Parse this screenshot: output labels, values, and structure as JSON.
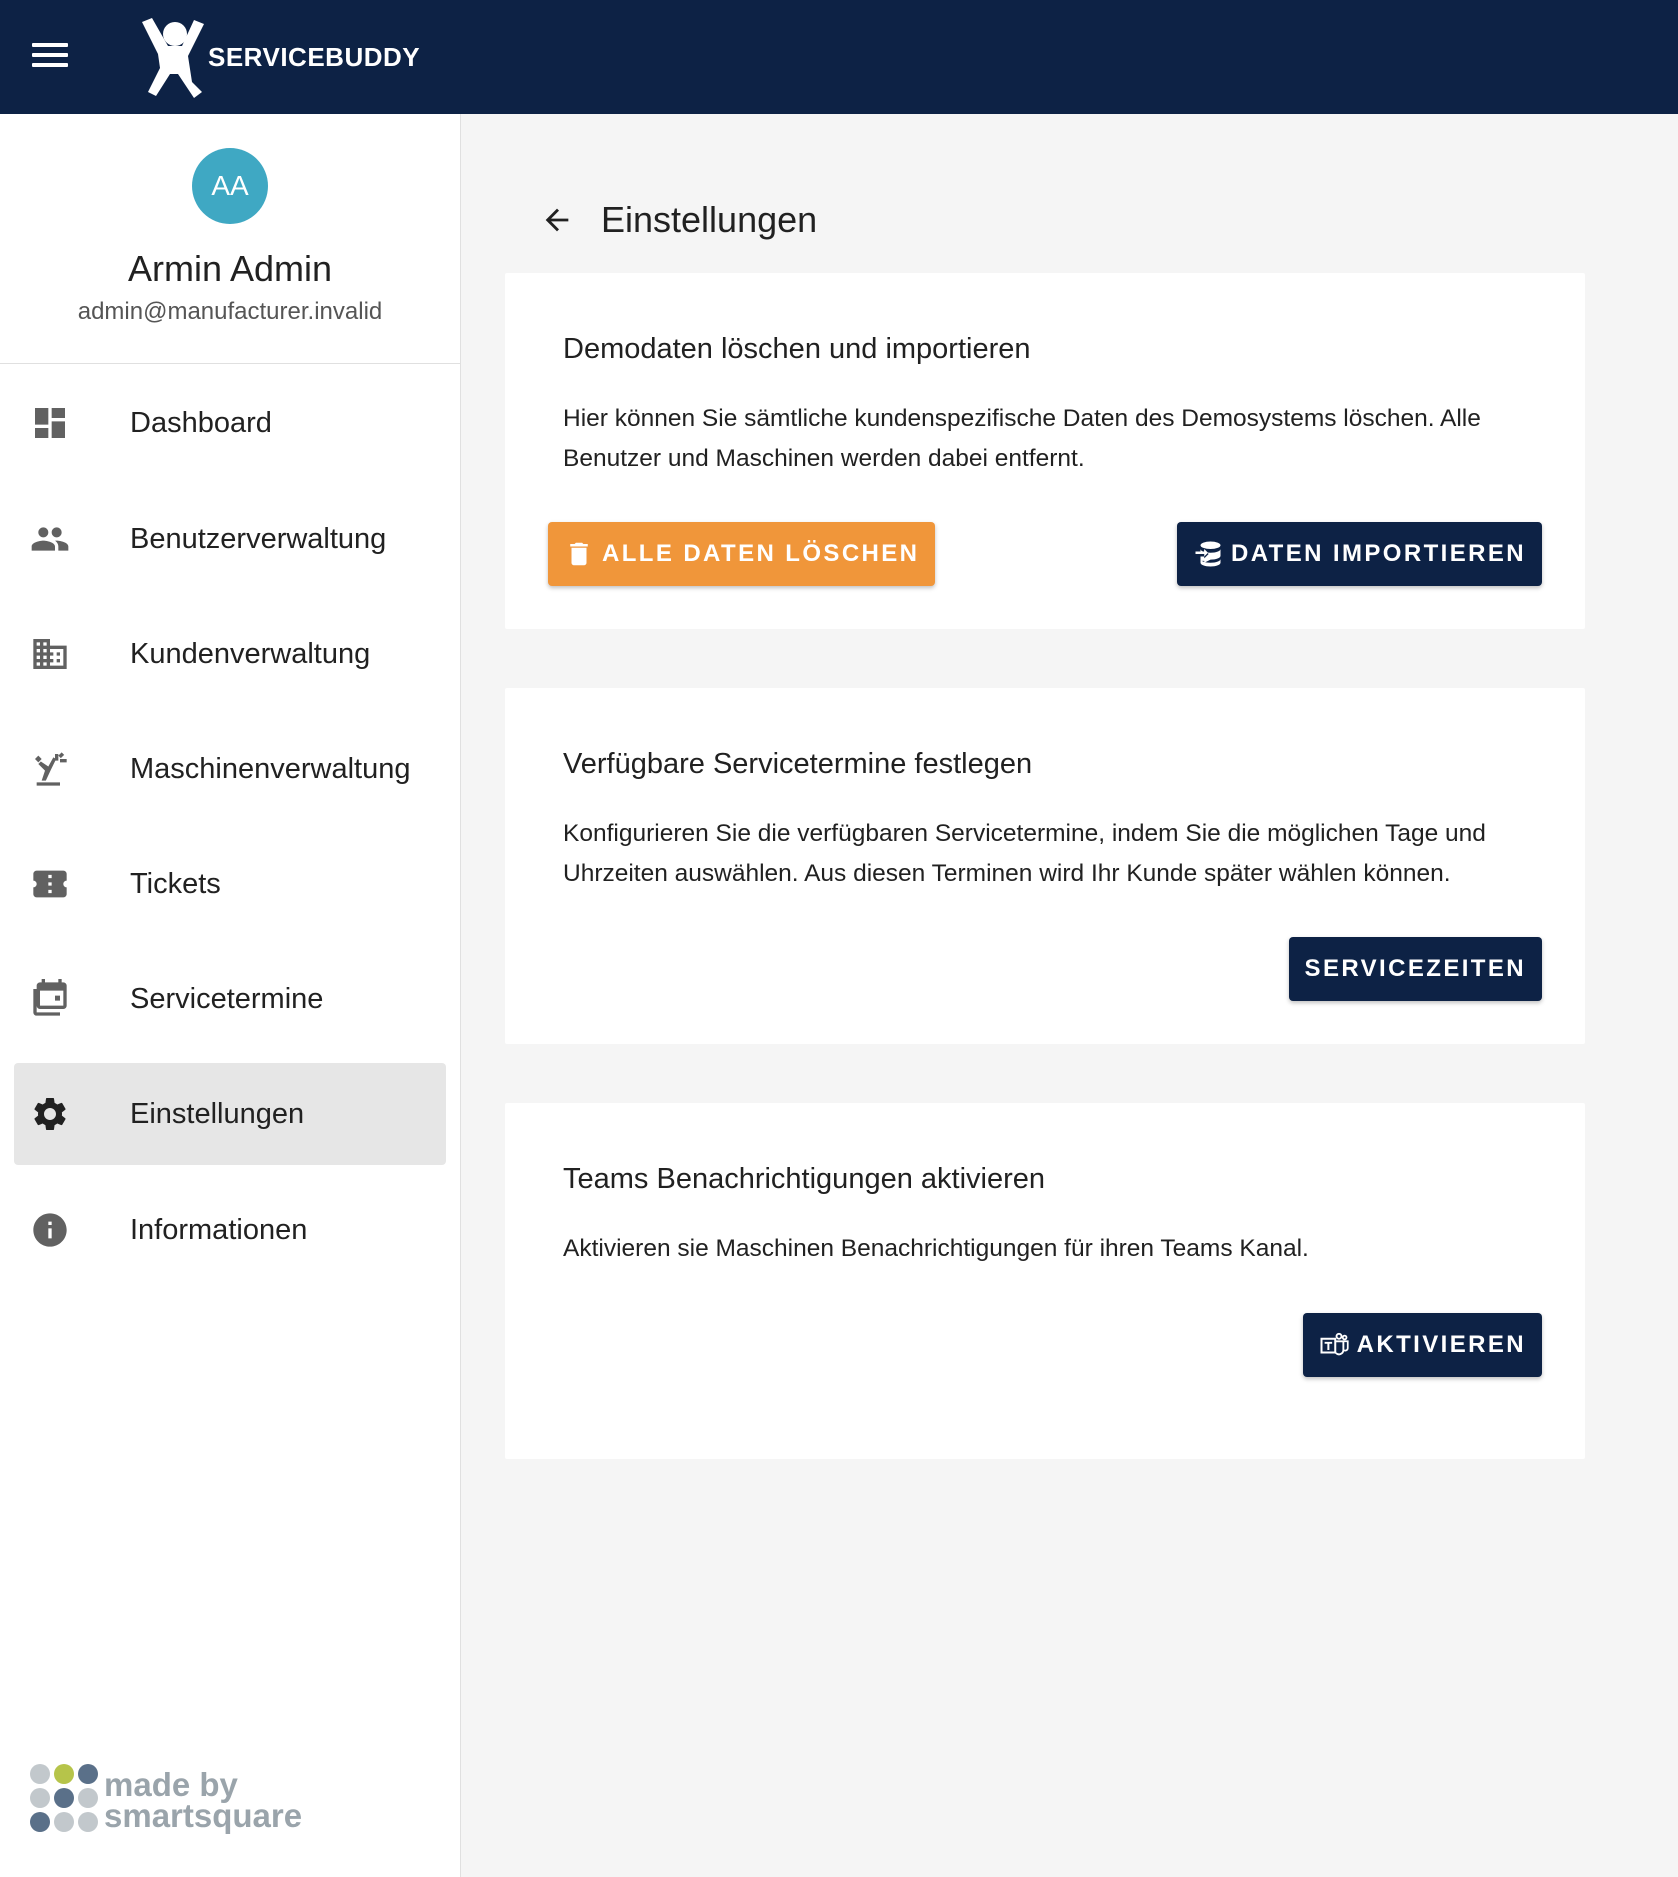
{
  "app": {
    "brand": "SERVICEBUDDY"
  },
  "user": {
    "initials": "AA",
    "name": "Armin Admin",
    "email": "admin@manufacturer.invalid"
  },
  "nav": {
    "items": [
      {
        "label": "Dashboard",
        "icon": "dashboard-icon"
      },
      {
        "label": "Benutzerverwaltung",
        "icon": "people-icon"
      },
      {
        "label": "Kundenverwaltung",
        "icon": "building-icon"
      },
      {
        "label": "Maschinenverwaltung",
        "icon": "machine-arm-icon"
      },
      {
        "label": "Tickets",
        "icon": "ticket-icon"
      },
      {
        "label": "Servicetermine",
        "icon": "calendar-stack-icon"
      },
      {
        "label": "Einstellungen",
        "icon": "gear-icon",
        "active": true
      },
      {
        "label": "Informationen",
        "icon": "info-icon"
      }
    ]
  },
  "footer": {
    "made_by_line1": "made by",
    "made_by_line2": "smartsquare"
  },
  "page": {
    "title": "Einstellungen"
  },
  "cards": [
    {
      "title": "Demodaten löschen und importieren",
      "text": "Hier können Sie sämtliche kundenspezifische Daten des Demosystems löschen. Alle Benutzer und Maschinen werden dabei entfernt.",
      "buttons": [
        {
          "label": "ALLE DATEN LÖSCHEN",
          "icon": "trash-icon"
        },
        {
          "label": "DATEN IMPORTIEREN",
          "icon": "database-import-icon"
        }
      ]
    },
    {
      "title": "Verfügbare Servicetermine festlegen",
      "text": "Konfigurieren Sie die verfügbaren Servicetermine, indem Sie die möglichen Tage und Uhrzeiten auswählen. Aus diesen Terminen wird Ihr Kunde später wählen können.",
      "buttons": [
        {
          "label": "SERVICEZEITEN"
        }
      ]
    },
    {
      "title": "Teams Benachrichtigungen aktivieren",
      "text": "Aktivieren sie Maschinen Benachrichtigungen für ihren Teams Kanal.",
      "buttons": [
        {
          "label": "AKTIVIEREN",
          "icon": "teams-icon"
        }
      ]
    }
  ],
  "colors": {
    "topbar": "#0d2245",
    "primary": "#0d2245",
    "warning": "#f0963a",
    "avatar": "#3fa8c3",
    "active_nav": "#e6e6e6"
  }
}
